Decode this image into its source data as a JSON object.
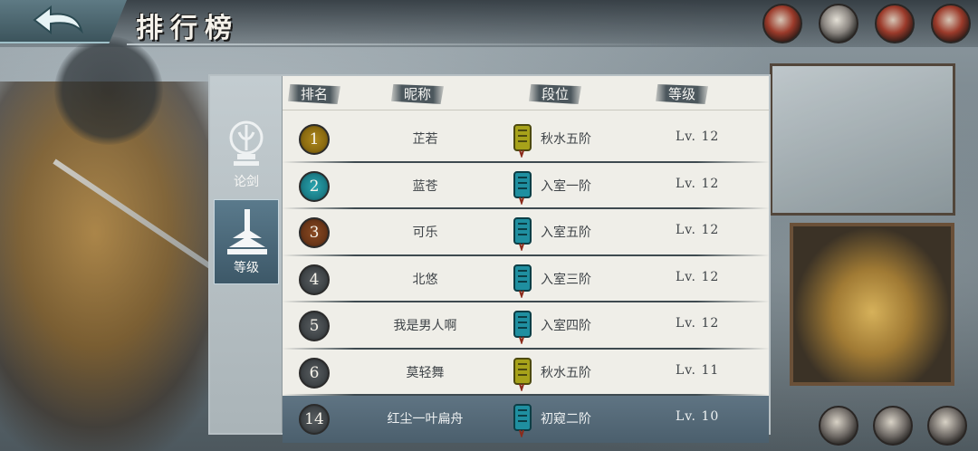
{
  "header": {
    "title": "排行榜"
  },
  "side_tabs": [
    {
      "label": "论剑",
      "active": false
    },
    {
      "label": "等级",
      "active": true
    }
  ],
  "table": {
    "columns": [
      "排名",
      "昵称",
      "段位",
      "等级"
    ],
    "rows": [
      {
        "rank": "1",
        "nickname": "芷若",
        "tier": "秋水五阶",
        "level": "Lv. 12",
        "badge": "gold",
        "tier_color": "#a7a21a"
      },
      {
        "rank": "2",
        "nickname": "蓝苍",
        "tier": "入室一阶",
        "level": "Lv. 12",
        "badge": "teal",
        "tier_color": "#1f8fa0"
      },
      {
        "rank": "3",
        "nickname": "可乐",
        "tier": "入室五阶",
        "level": "Lv. 12",
        "badge": "brown",
        "tier_color": "#1f8fa0"
      },
      {
        "rank": "4",
        "nickname": "北悠",
        "tier": "入室三阶",
        "level": "Lv. 12",
        "badge": "gray",
        "tier_color": "#1f8fa0"
      },
      {
        "rank": "5",
        "nickname": "我是男人啊",
        "tier": "入室四阶",
        "level": "Lv. 12",
        "badge": "gray",
        "tier_color": "#1f8fa0"
      },
      {
        "rank": "6",
        "nickname": "莫轻舞",
        "tier": "秋水五阶",
        "level": "Lv. 11",
        "badge": "gray",
        "tier_color": "#a7a21a"
      }
    ],
    "self_row": {
      "rank": "14",
      "nickname": "红尘一叶扁舟",
      "tier": "初窥二阶",
      "level": "Lv. 10",
      "badge": "gray",
      "tier_color": "#1f8fa0"
    }
  },
  "colors": {
    "accent_teal": "#1f8fa0",
    "accent_gold": "#a7a21a",
    "panel_bg": "#efeee8",
    "active_tab": "#4b6676"
  },
  "icons": {
    "back": "back-arrow-icon",
    "tab_lunjian": "sword-emblem-icon",
    "tab_level": "pagoda-icon",
    "tier": "scroll-tier-icon"
  }
}
